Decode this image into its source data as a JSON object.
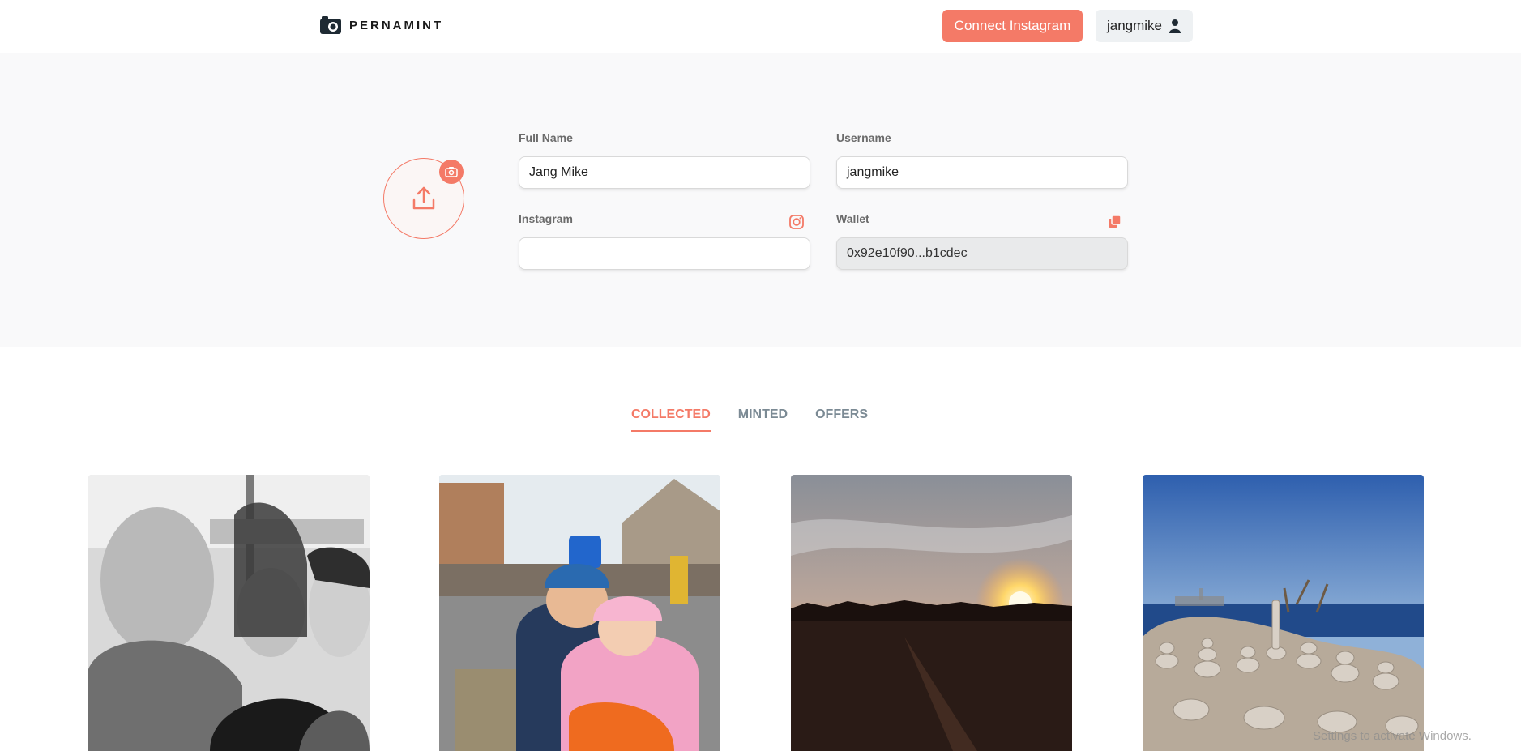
{
  "header": {
    "brand": "PERNAMINT",
    "connect_button": "Connect Instagram",
    "username": "jangmike"
  },
  "profile": {
    "full_name_label": "Full Name",
    "full_name_value": "Jang Mike",
    "username_label": "Username",
    "username_value": "jangmike",
    "instagram_label": "Instagram",
    "instagram_value": "",
    "wallet_label": "Wallet",
    "wallet_value": "0x92e10f90...b1cdec"
  },
  "tabs": [
    {
      "label": "COLLECTED",
      "active": true
    },
    {
      "label": "MINTED",
      "active": false
    },
    {
      "label": "OFFERS",
      "active": false
    }
  ],
  "gallery": [
    {
      "name": "group-selfie-photo"
    },
    {
      "name": "kids-photo"
    },
    {
      "name": "sunset-photo"
    },
    {
      "name": "rock-stacks-photo"
    }
  ],
  "watermark": "Settings to activate Windows.",
  "colors": {
    "accent": "#f47a67",
    "tab_inactive": "#7b8a94",
    "profile_bg": "#f9f9fa"
  }
}
